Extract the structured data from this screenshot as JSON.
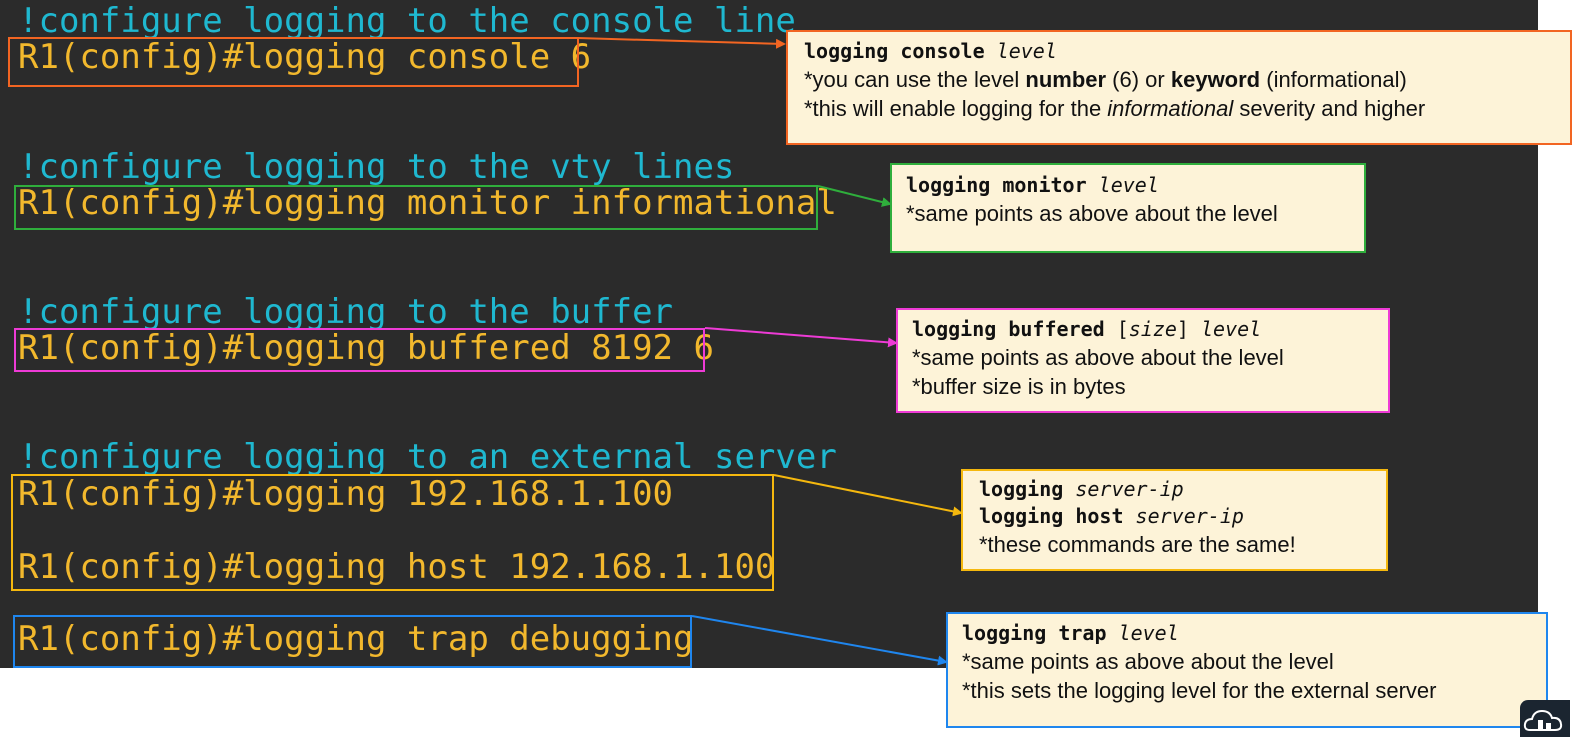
{
  "sections": [
    {
      "comment": "!configure logging to the console line",
      "commands": [
        "R1(config)#logging console 6"
      ],
      "color": "#f26522"
    },
    {
      "comment": "!configure logging to the vty lines",
      "commands": [
        "R1(config)#logging monitor informational"
      ],
      "color": "#2fae3c"
    },
    {
      "comment": "!configure logging to the buffer",
      "commands": [
        "R1(config)#logging buffered 8192 6"
      ],
      "color": "#ee3bd6"
    },
    {
      "comment": "!configure logging to an external server",
      "commands": [
        "R1(config)#logging 192.168.1.100",
        "R1(config)#logging host 192.168.1.100"
      ],
      "color": "#f5b80e"
    },
    {
      "comment": "",
      "commands": [
        "R1(config)#logging trap debugging"
      ],
      "color": "#1f86ee"
    }
  ],
  "notes": {
    "console": {
      "syntax_cmd": "logging console",
      "syntax_arg": "level",
      "line1_pre": "*you can use the level ",
      "line1_b1": "number",
      "line1_mid": " (6) or ",
      "line1_b2": "keyword",
      "line1_post": " (informational)",
      "line2_pre": "*this will enable logging for the ",
      "line2_i": "informational",
      "line2_post": " severity and higher"
    },
    "monitor": {
      "syntax_cmd": "logging monitor",
      "syntax_arg": "level",
      "line1": "*same points as above about the level"
    },
    "buffered": {
      "syntax_cmd": "logging buffered",
      "syntax_lb": "[",
      "syntax_size": "size",
      "syntax_rb": "]",
      "syntax_arg": "level",
      "line1": "*same points as above about the level",
      "line2": "*buffer size is in bytes"
    },
    "server": {
      "syntax1_cmd": "logging",
      "syntax1_arg": "server-ip",
      "syntax2_cmd": "logging host",
      "syntax2_arg": "server-ip",
      "line1": "*these commands are the same!"
    },
    "trap": {
      "syntax_cmd": "logging trap",
      "syntax_arg": "level",
      "line1": "*same points as above about the level",
      "line2": "*this sets the logging level for the external server"
    }
  }
}
